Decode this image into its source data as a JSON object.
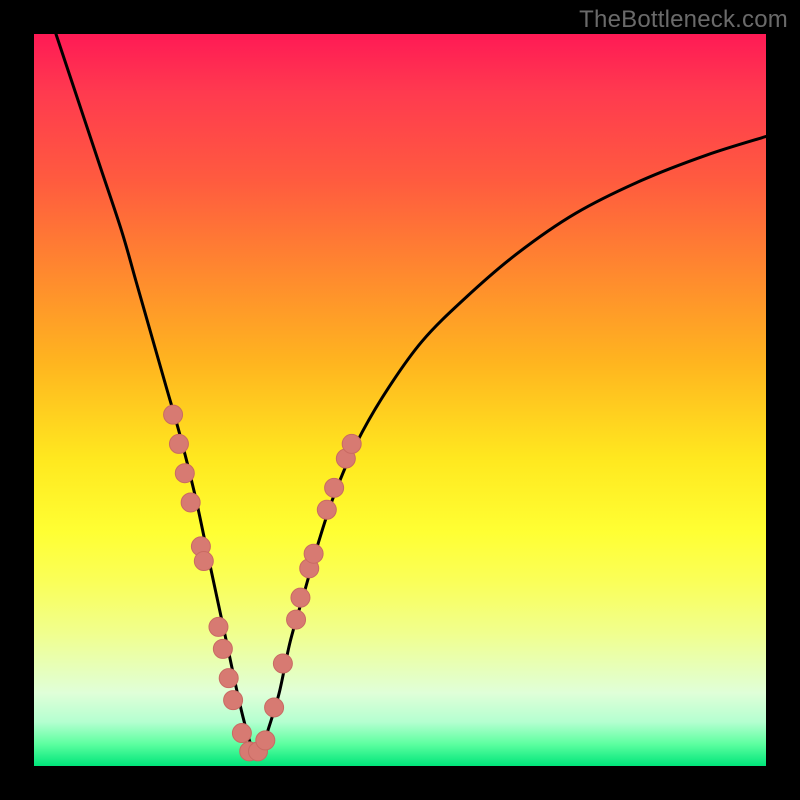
{
  "watermark_text": "TheBottleneck.com",
  "colors": {
    "frame": "#000000",
    "curve_stroke": "#000000",
    "marker_fill": "#d77a72",
    "marker_stroke": "#c96a63"
  },
  "chart_data": {
    "type": "line",
    "title": "",
    "xlabel": "",
    "ylabel": "",
    "xlim": [
      0,
      100
    ],
    "ylim": [
      0,
      100
    ],
    "series": [
      {
        "name": "bottleneck-curve",
        "x": [
          3,
          6,
          9,
          12,
          14,
          16,
          18,
          20,
          22,
          23.5,
          25,
          26.5,
          28,
          29,
          30,
          31,
          32,
          33.5,
          35,
          37,
          39,
          41,
          44,
          48,
          53,
          59,
          66,
          74,
          83,
          92,
          100
        ],
        "y": [
          100,
          91,
          82,
          73,
          66,
          59,
          52,
          45,
          37,
          30,
          23,
          16,
          9,
          5,
          2,
          2,
          5,
          10,
          17,
          24,
          31,
          37,
          44,
          51,
          58,
          64,
          70,
          75.5,
          80,
          83.5,
          86
        ]
      }
    ],
    "markers": [
      {
        "x": 19.0,
        "y": 48
      },
      {
        "x": 19.8,
        "y": 44
      },
      {
        "x": 20.6,
        "y": 40
      },
      {
        "x": 21.4,
        "y": 36
      },
      {
        "x": 22.8,
        "y": 30
      },
      {
        "x": 23.2,
        "y": 28
      },
      {
        "x": 25.2,
        "y": 19
      },
      {
        "x": 25.8,
        "y": 16
      },
      {
        "x": 26.6,
        "y": 12
      },
      {
        "x": 27.2,
        "y": 9
      },
      {
        "x": 28.4,
        "y": 4.5
      },
      {
        "x": 29.4,
        "y": 2.0
      },
      {
        "x": 30.6,
        "y": 2.0
      },
      {
        "x": 31.6,
        "y": 3.5
      },
      {
        "x": 32.8,
        "y": 8
      },
      {
        "x": 34.0,
        "y": 14
      },
      {
        "x": 35.8,
        "y": 20
      },
      {
        "x": 36.4,
        "y": 23
      },
      {
        "x": 37.6,
        "y": 27
      },
      {
        "x": 38.2,
        "y": 29
      },
      {
        "x": 40.0,
        "y": 35
      },
      {
        "x": 41.0,
        "y": 38
      },
      {
        "x": 42.6,
        "y": 42
      },
      {
        "x": 43.4,
        "y": 44
      }
    ]
  }
}
